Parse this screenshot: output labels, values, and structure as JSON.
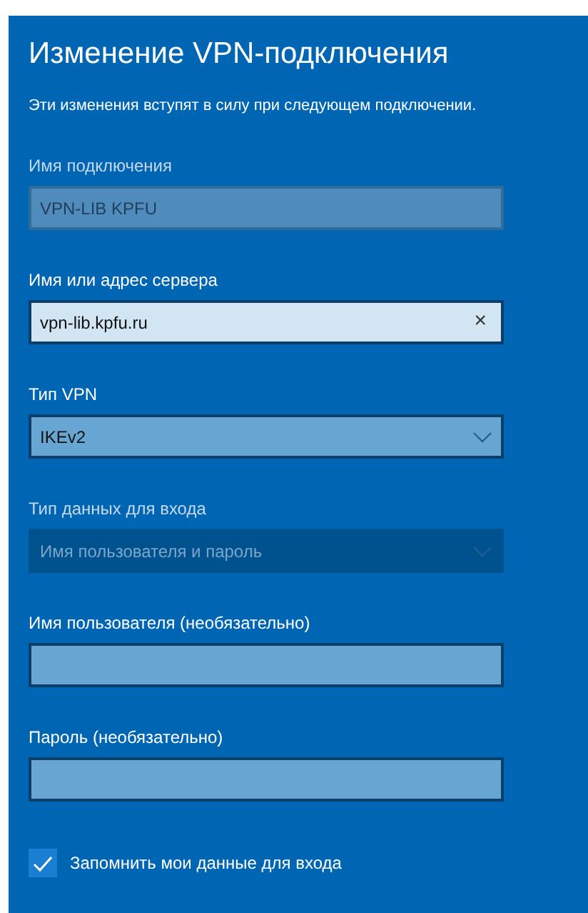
{
  "title": "Изменение VPN-подключения",
  "subtitle": "Эти изменения вступят в силу при следующем подключении.",
  "fields": [
    {
      "kind": "text",
      "label": "Имя подключения",
      "value": "VPN-LIB KPFU",
      "disabled": true,
      "focused": false
    },
    {
      "kind": "text",
      "label": "Имя или адрес сервера",
      "value": "vpn-lib.kpfu.ru",
      "disabled": false,
      "focused": true,
      "clear": "×"
    },
    {
      "kind": "select",
      "label": "Тип VPN",
      "value": "IKEv2",
      "disabled": false
    },
    {
      "kind": "select",
      "label": "Тип данных для входа",
      "value": "Имя пользователя и пароль",
      "disabled": true
    },
    {
      "kind": "text",
      "label": "Имя пользователя (необязательно)",
      "disabled": false,
      "focused": false
    },
    {
      "kind": "text",
      "label": "Пароль (необязательно)",
      "disabled": false,
      "focused": false
    }
  ],
  "remember": {
    "label": "Запомнить мои данные для входа",
    "checked": true
  }
}
